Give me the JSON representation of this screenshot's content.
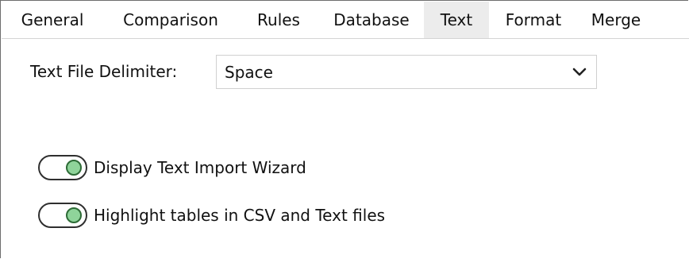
{
  "tabs": [
    {
      "label": "General"
    },
    {
      "label": "Comparison"
    },
    {
      "label": "Rules"
    },
    {
      "label": "Database"
    },
    {
      "label": "Text"
    },
    {
      "label": "Format"
    },
    {
      "label": "Merge"
    }
  ],
  "active_tab": "Text",
  "delimiter": {
    "label": "Text File Delimiter:",
    "value": "Space",
    "icon": "chevron-down-icon"
  },
  "options": [
    {
      "label": "Display Text Import Wizard",
      "checked": true
    },
    {
      "label": "Highlight tables in CSV and Text files",
      "checked": true
    }
  ],
  "colors": {
    "active_tab_bg": "#ececec",
    "toggle_knob": "#8fd49a",
    "toggle_knob_border": "#2d6b36"
  }
}
